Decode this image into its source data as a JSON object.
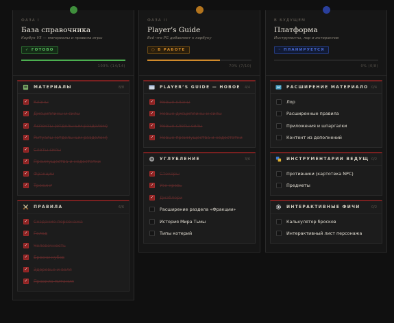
{
  "columns": [
    {
      "phase": "ФАЗА I",
      "title": "База справочника",
      "subtitle": "Корбук V5 — материалы и правила игры",
      "status": "✓ ГОТОВО",
      "status_kind": "done",
      "dot_color": "#3f8f3c",
      "progress_color": "#4caf50",
      "progress": 1.0,
      "progress_text": "100% (14/14)",
      "sections": [
        {
          "icon": "book-icon",
          "title": "МАТЕРИАЛЫ",
          "count": "8/8",
          "items": [
            {
              "label": "Кланы",
              "done": true
            },
            {
              "label": "Дисциплины и силы",
              "done": true
            },
            {
              "label": "Аспекты (отдельным разделом)",
              "done": true
            },
            {
              "label": "Ритуалы (отдельным разделом)",
              "done": true
            },
            {
              "label": "Слоты силы",
              "done": true
            },
            {
              "label": "Преимущества и недостатки",
              "done": true
            },
            {
              "label": "Фракции",
              "done": true
            },
            {
              "label": "Трекинг",
              "done": true
            }
          ]
        },
        {
          "icon": "crossed-swords-icon",
          "title": "ПРАВИЛА",
          "count": "6/6",
          "items": [
            {
              "label": "Создание персонажа",
              "done": true
            },
            {
              "label": "Голод",
              "done": true
            },
            {
              "label": "Человечность",
              "done": true
            },
            {
              "label": "Броски кубов",
              "done": true
            },
            {
              "label": "Здоровье и воля",
              "done": true
            },
            {
              "label": "Правила питания",
              "done": true
            }
          ]
        }
      ]
    },
    {
      "phase": "ФАЗА II",
      "title": "Player’s Guide",
      "subtitle": "Всё что PG добавляет к корбуку",
      "status": "○ В РАБОТЕ",
      "status_kind": "work",
      "dot_color": "#b3741d",
      "progress_color": "#d08a2b",
      "progress": 0.7,
      "progress_text": "70% (7/10)",
      "sections": [
        {
          "icon": "window-icon",
          "title": "PLAYER’S GUIDE — НОВОЕ",
          "count": "4/4",
          "items": [
            {
              "label": "Новые кланы",
              "done": true
            },
            {
              "label": "Новые дисциплины и силы",
              "done": true
            },
            {
              "label": "Новые слоты силы",
              "done": true
            },
            {
              "label": "Новые преимущества и недостатки",
              "done": true
            }
          ]
        },
        {
          "icon": "globe-icon",
          "title": "УГЛУБЛЕНИЕ",
          "count": "3/6",
          "items": [
            {
              "label": "Стекеры",
              "done": true
            },
            {
              "label": "Уэк кровь",
              "done": true
            },
            {
              "label": "Диаблери",
              "done": true
            },
            {
              "label": "Расширение раздела «Фракции»",
              "done": false
            },
            {
              "label": "История Мира Тьмы",
              "done": false
            },
            {
              "label": "Типы котерий",
              "done": false
            }
          ]
        }
      ]
    },
    {
      "phase": "В БУДУЩЕМ",
      "title": "Платформа",
      "subtitle": "Инструменты, лор и интерактив",
      "status": "◦ ПЛАНИРУЕТСЯ",
      "status_kind": "plan",
      "dot_color": "#2a3f9c",
      "progress_color": "#3a55c4",
      "progress": 0.0,
      "progress_text": "0% (0/8)",
      "sections": [
        {
          "icon": "map-icon",
          "title": "РАСШИРЕНИЕ МАТЕРИАЛОВ",
          "count": "0/4",
          "items": [
            {
              "label": "Лор",
              "done": false
            },
            {
              "label": "Расширенные правила",
              "done": false
            },
            {
              "label": "Приложения и шпаргалки",
              "done": false
            },
            {
              "label": "Контент из дополнений",
              "done": false
            }
          ]
        },
        {
          "icon": "tools-icon",
          "title": "ИНСТРУМЕНТАРИЙ ВЕДУЩЕГО",
          "count": "0/2",
          "items": [
            {
              "label": "Противники (картотека NPC)",
              "done": false
            },
            {
              "label": "Предметы",
              "done": false
            }
          ]
        },
        {
          "icon": "gear-icon",
          "title": "ИНТЕРАКТИВНЫЕ ФИЧИ",
          "count": "0/2",
          "items": [
            {
              "label": "Калькулятор бросков",
              "done": false
            },
            {
              "label": "Интерактивный лист персонажа",
              "done": false
            }
          ]
        }
      ]
    }
  ]
}
